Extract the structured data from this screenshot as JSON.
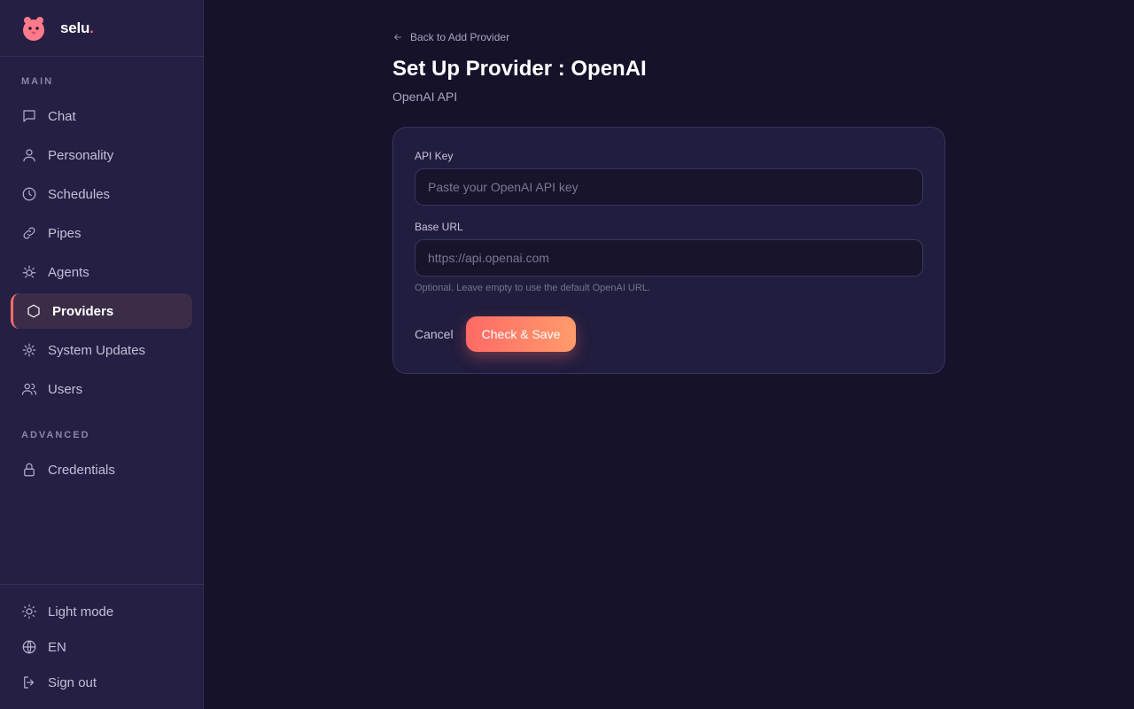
{
  "brand": {
    "name": "selu",
    "dot": "."
  },
  "sidebar": {
    "main_label": "MAIN",
    "advanced_label": "ADVANCED",
    "items": [
      {
        "label": "Chat",
        "icon": "chat-icon"
      },
      {
        "label": "Personality",
        "icon": "user-icon"
      },
      {
        "label": "Schedules",
        "icon": "clock-icon"
      },
      {
        "label": "Pipes",
        "icon": "link-icon"
      },
      {
        "label": "Agents",
        "icon": "bug-icon"
      },
      {
        "label": "Providers",
        "icon": "hexagon-icon",
        "active": true
      },
      {
        "label": "System Updates",
        "icon": "gear-icon"
      },
      {
        "label": "Users",
        "icon": "users-icon"
      }
    ],
    "advanced_items": [
      {
        "label": "Credentials",
        "icon": "lock-icon"
      }
    ],
    "footer": [
      {
        "label": "Light mode",
        "icon": "sun-icon"
      },
      {
        "label": "EN",
        "icon": "globe-icon"
      },
      {
        "label": "Sign out",
        "icon": "sign-out-icon"
      }
    ]
  },
  "main": {
    "back_label": "Back to Add Provider",
    "title": "Set Up Provider : OpenAI",
    "subtitle": "OpenAI API",
    "form": {
      "api_key_label": "API Key",
      "api_key_placeholder": "Paste your OpenAI API key",
      "api_key_value": "",
      "base_url_label": "Base URL",
      "base_url_placeholder": "https://api.openai.com",
      "base_url_value": "",
      "base_url_hint": "Optional. Leave empty to use the default OpenAI URL.",
      "cancel_label": "Cancel",
      "save_label": "Check & Save"
    }
  },
  "colors": {
    "background": "#15122a",
    "sidebar": "#241f43",
    "accent": "#ff6a66",
    "accent_end": "#ff9b6a"
  }
}
